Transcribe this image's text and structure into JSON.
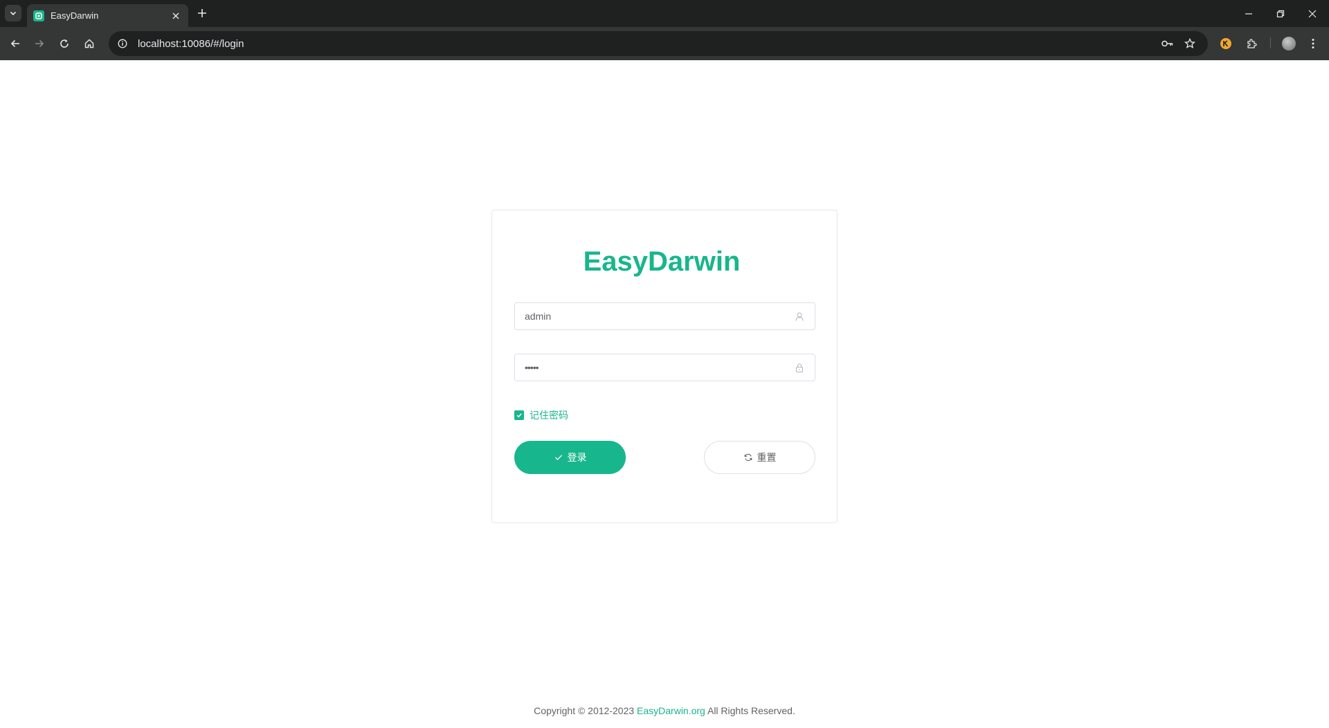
{
  "browser": {
    "tab": {
      "title": "EasyDarwin"
    },
    "url": "localhost:10086/#/login"
  },
  "login": {
    "title": "EasyDarwin",
    "username_value": "admin",
    "password_value": "•••••",
    "remember_label": "记住密码",
    "remember_checked": true,
    "login_button": "登录",
    "reset_button": "重置"
  },
  "footer": {
    "prefix": "Copyright © 2012-2023 ",
    "link": "EasyDarwin.org",
    "suffix": " All Rights Reserved."
  },
  "colors": {
    "accent": "#18b68c",
    "chrome_dark": "#1f2020",
    "chrome_toolbar": "#353636"
  },
  "icons": {
    "tab_menu": "chevron-down-icon",
    "new_tab": "plus-icon",
    "back": "arrow-left-icon",
    "forward": "arrow-right-icon",
    "reload": "reload-icon",
    "home": "home-icon",
    "site_info": "info-icon",
    "password_key": "key-icon",
    "bookmark": "star-icon",
    "extension": "puzzle-icon",
    "menu": "more-vert-icon",
    "user_field": "user-icon",
    "password_field": "lock-icon",
    "login": "check-icon",
    "reset": "refresh-icon"
  }
}
